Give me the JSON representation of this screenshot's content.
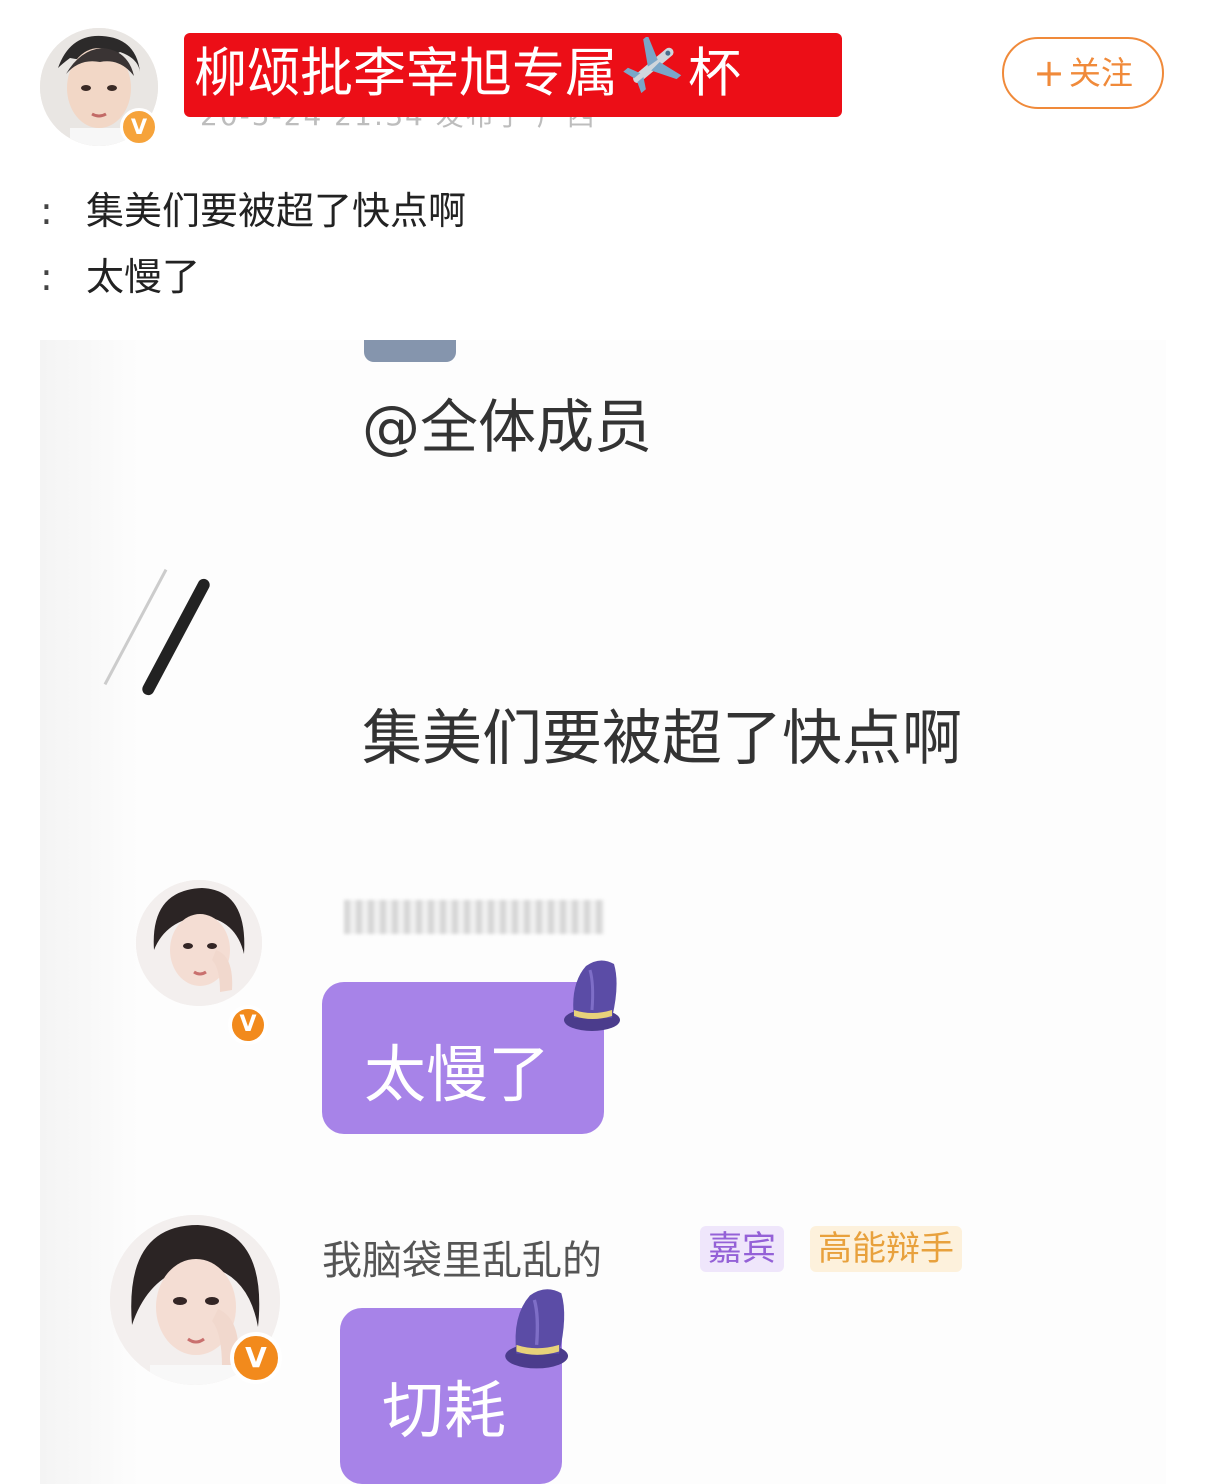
{
  "post": {
    "title": "柳颂批李宰旭专属✈️杯",
    "title_parts": [
      "柳颂批李宰旭专属",
      "杯"
    ],
    "meta": "20-5-24 21:34  发布于 广西",
    "follow_label": "关注",
    "follow_plus": "+",
    "verified_badge": "V",
    "lines": [
      {
        "colon": ":",
        "text": "集美们要被超了快点啊"
      },
      {
        "colon": ":",
        "text": "太慢了"
      }
    ]
  },
  "screenshot": {
    "mention": "@全体成员",
    "message_main": "集美们要被超了快点啊",
    "bubble1_text": "太慢了",
    "user2_name": "我脑袋里乱乱的",
    "tag_guest": "嘉宾",
    "tag_debate": "高能辩手",
    "bubble2_text": "切耗",
    "badge_letter": "V"
  },
  "colors": {
    "title_bg": "#ec0e17",
    "follow_accent": "#f08a3a",
    "bubble_purple": "#a783e8",
    "badge_orange": "#f28a1c"
  },
  "icons": [
    "verified-badge-icon",
    "airplane-icon",
    "plus-icon",
    "wizard-hat-icon"
  ]
}
